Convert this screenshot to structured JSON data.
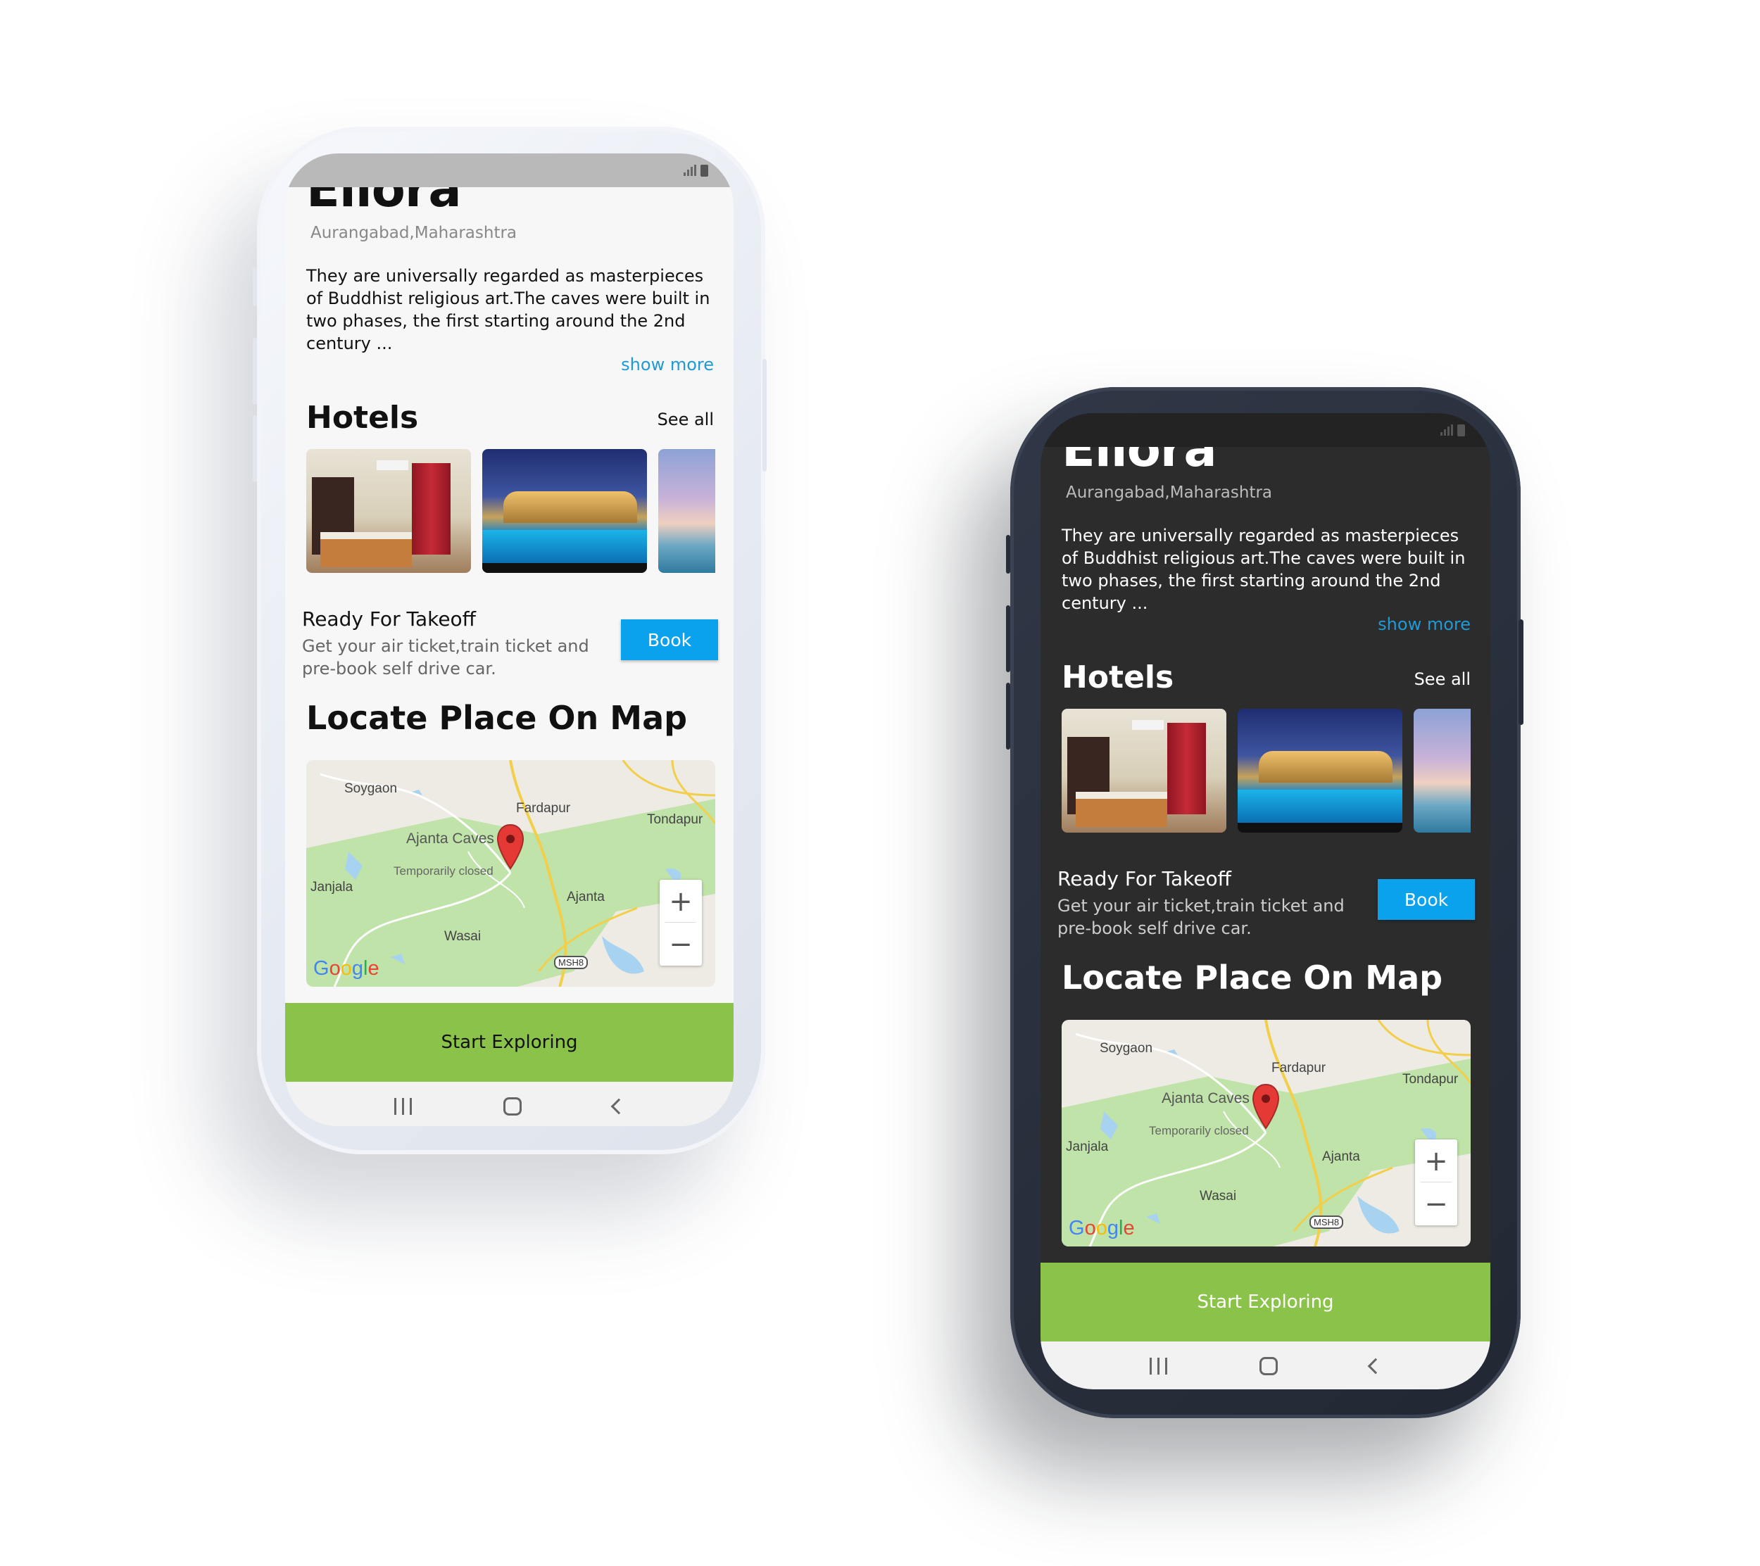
{
  "app": {
    "place_title": "Ellora",
    "location": "Aurangabad,Maharashtra",
    "description": "They are universally regarded as masterpieces of Buddhist religious art.The caves were built in two phases, the first starting around the 2nd century ...",
    "show_more": "show more",
    "hotels": {
      "title": "Hotels",
      "see_all": "See all",
      "images": [
        "hotel-room",
        "palace-pool",
        "sunset-pool"
      ]
    },
    "takeoff": {
      "title": "Ready For Takeoff",
      "subtitle": "Get your air ticket,train ticket and pre-book self drive car.",
      "book_label": "Book"
    },
    "map": {
      "title": "Locate Place On Map",
      "labels": {
        "soygaon": "Soygaon",
        "fardapur": "Fardapur",
        "tondapur": "Tondapur",
        "ajanta_caves": "Ajanta Caves",
        "temporarily_closed": "Temporarily closed",
        "janjala": "Janjala",
        "ajanta": "Ajanta",
        "wasai": "Wasai",
        "msh8": "MSH8",
        "google": "Google"
      },
      "zoom_in": "+",
      "zoom_out": "−"
    },
    "explore_label": "Start Exploring"
  },
  "colors": {
    "accent_green": "#8bc34a",
    "book_blue": "#0aa2ec",
    "link_blue": "#1e9ad6",
    "dark_bg": "#2c2c2c",
    "light_bg": "#f7f7f7",
    "map_park_green": "#bfe3a8",
    "map_water": "#a8d3f0",
    "map_road_yellow": "#f2cf4a",
    "pin_red": "#e53935"
  },
  "icons": [
    "signal-icon",
    "battery-icon",
    "map-pin-icon",
    "recents-icon",
    "home-icon",
    "back-icon"
  ]
}
